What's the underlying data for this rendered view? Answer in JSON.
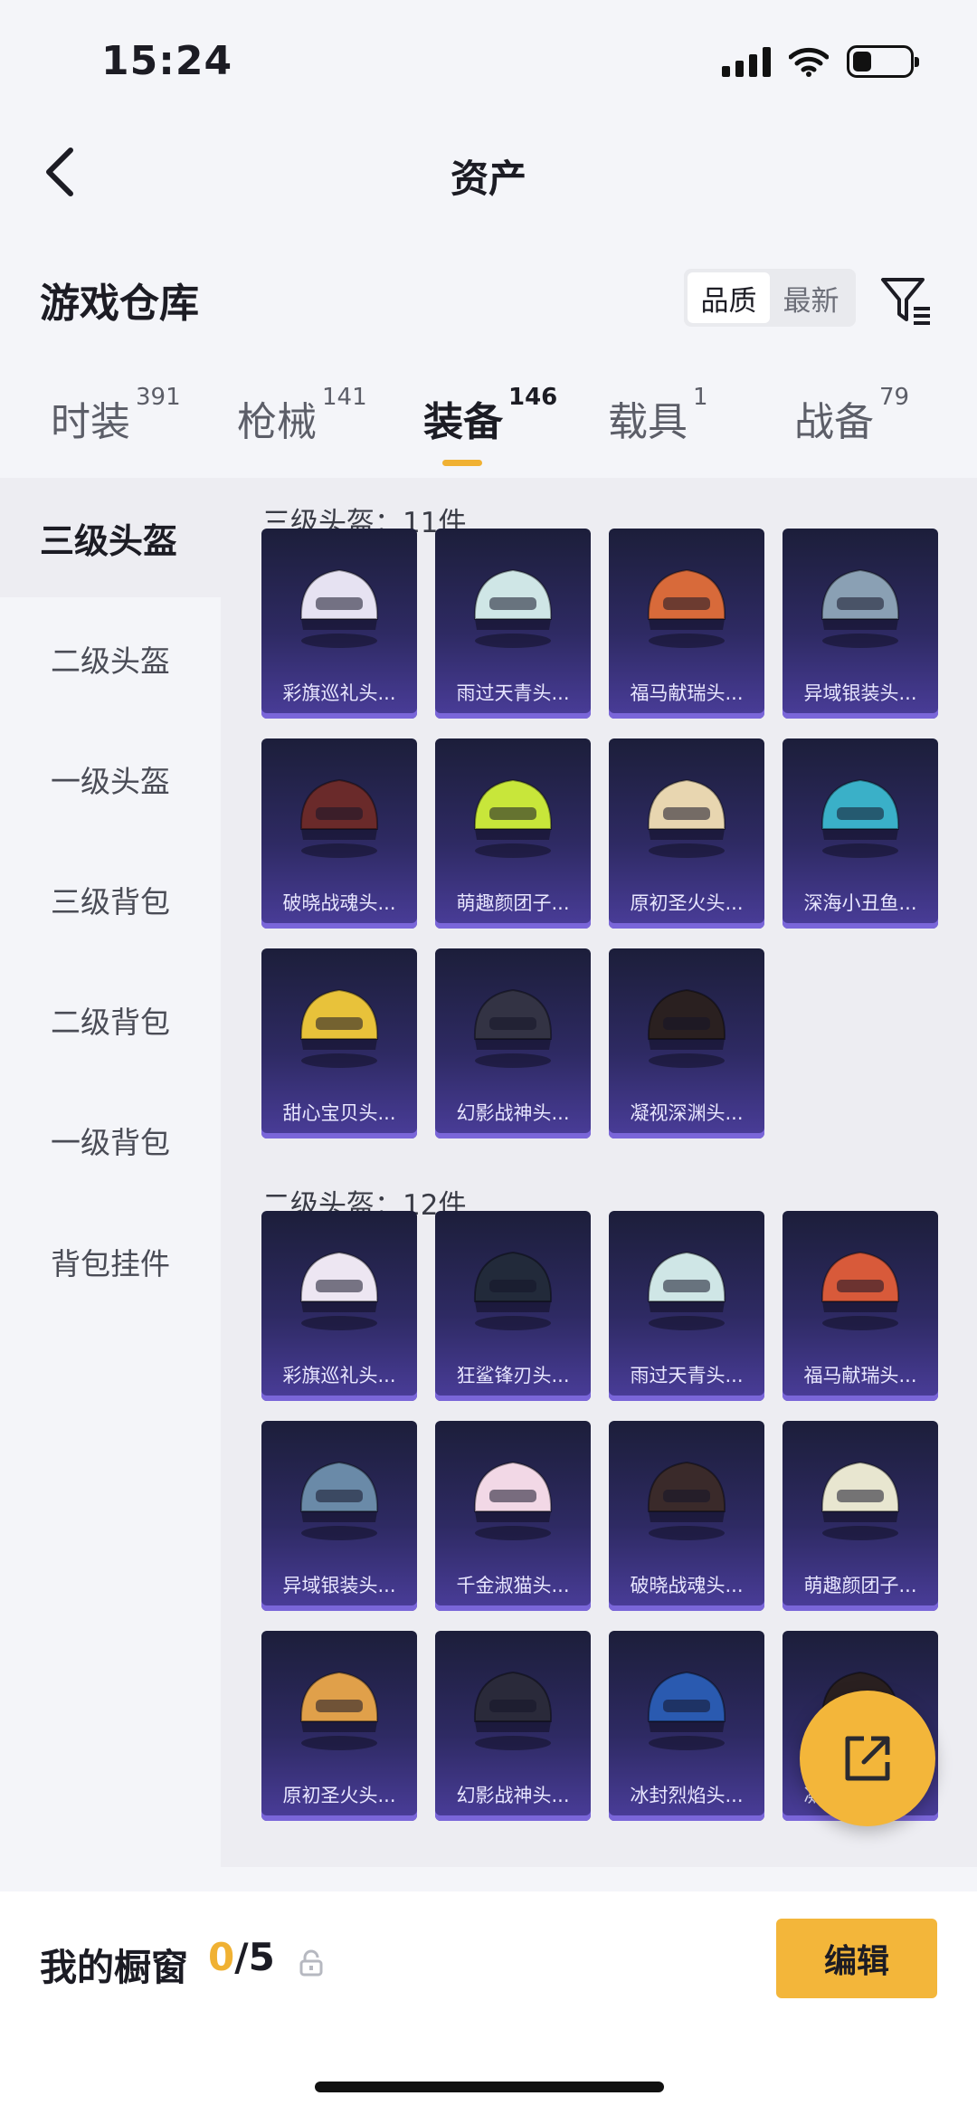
{
  "status_bar": {
    "time": "15:24"
  },
  "nav": {
    "title": "资产"
  },
  "header": {
    "title": "游戏仓库",
    "sort_quality": "品质",
    "sort_newest": "最新"
  },
  "tabs": [
    {
      "label": "时装",
      "count": "391"
    },
    {
      "label": "枪械",
      "count": "141"
    },
    {
      "label": "装备",
      "count": "146"
    },
    {
      "label": "载具",
      "count": "1"
    },
    {
      "label": "战备",
      "count": "79"
    }
  ],
  "sidebar": {
    "items": [
      "三级头盔",
      "二级头盔",
      "一级头盔",
      "三级背包",
      "二级背包",
      "一级背包",
      "背包挂件"
    ]
  },
  "groups": [
    {
      "label": "三级头盔：11件",
      "items": [
        "彩旗巡礼头...",
        "雨过天青头...",
        "福马献瑞头...",
        "异域银装头...",
        "破晓战魂头...",
        "萌趣颜团子...",
        "原初圣火头...",
        "深海小丑鱼...",
        "甜心宝贝头...",
        "幻影战神头...",
        "凝视深渊头..."
      ]
    },
    {
      "label": "二级头盔：12件",
      "items": [
        "彩旗巡礼头...",
        "狂鲨锋刃头...",
        "雨过天青头...",
        "福马献瑞头...",
        "异域银装头...",
        "千金淑猫头...",
        "破晓战魂头...",
        "萌趣颜团子...",
        "原初圣火头...",
        "幻影战神头...",
        "冰封烈焰头...",
        "凝视深渊头..."
      ]
    }
  ],
  "bottom_bar": {
    "showcase_label": "我的橱窗",
    "showcase_current": "0",
    "showcase_total": "/5",
    "edit_label": "编辑"
  },
  "colors": {
    "accent": "#f0b133",
    "card_top": "#1c1e3a",
    "card_bottom": "#4a3d9a"
  }
}
